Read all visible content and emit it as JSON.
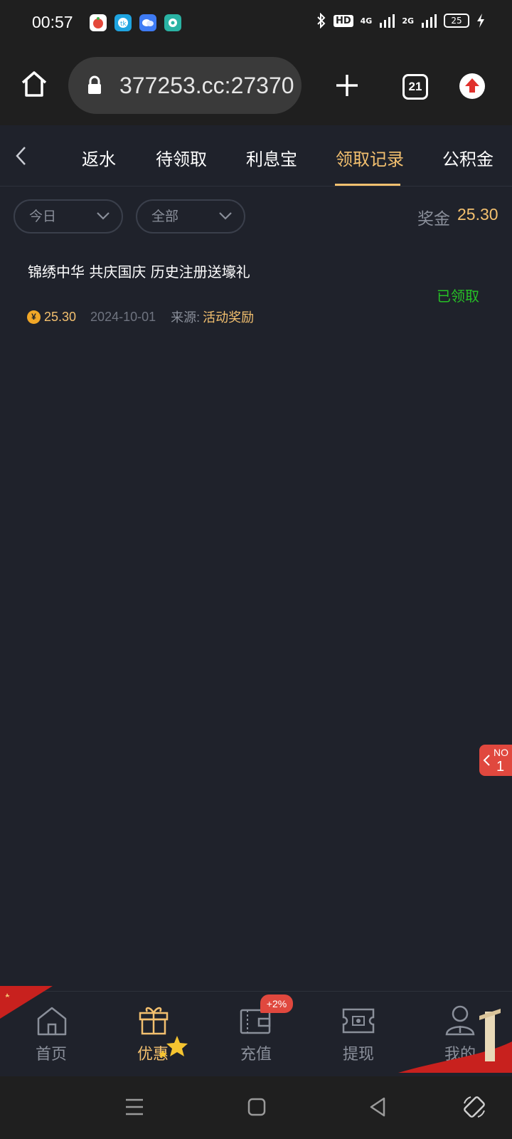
{
  "status_bar": {
    "time": "00:57",
    "hd_label": "HD",
    "network_4g": "4G",
    "network_2g": "2G",
    "battery_level": "25"
  },
  "browser": {
    "url": "377253.cc:27370",
    "tab_count": "21"
  },
  "nav_tabs": [
    {
      "label": "返水"
    },
    {
      "label": "待领取"
    },
    {
      "label": "利息宝"
    },
    {
      "label": "领取记录"
    },
    {
      "label": "公积金"
    }
  ],
  "filters": {
    "date_value": "今日",
    "type_value": "全部"
  },
  "summary": {
    "bonus_label": "奖金",
    "bonus_value": "25.30"
  },
  "records": [
    {
      "title": "锦绣中华 共庆国庆 历史注册送壕礼",
      "status": "已领取",
      "amount": "25.30",
      "date": "2024-10-01",
      "source_label": "来源:",
      "source_value": "活动奖励"
    }
  ],
  "float_badge": {
    "top": "NO",
    "bottom": "1"
  },
  "bottom_nav": [
    {
      "label": "首页"
    },
    {
      "label": "优惠"
    },
    {
      "label": "充值",
      "badge": "+2%"
    },
    {
      "label": "提现"
    },
    {
      "label": "我的"
    }
  ],
  "colors": {
    "accent": "#f3c06f",
    "background": "#1f222b",
    "success": "#26c026",
    "badge_red": "#e0483e"
  }
}
